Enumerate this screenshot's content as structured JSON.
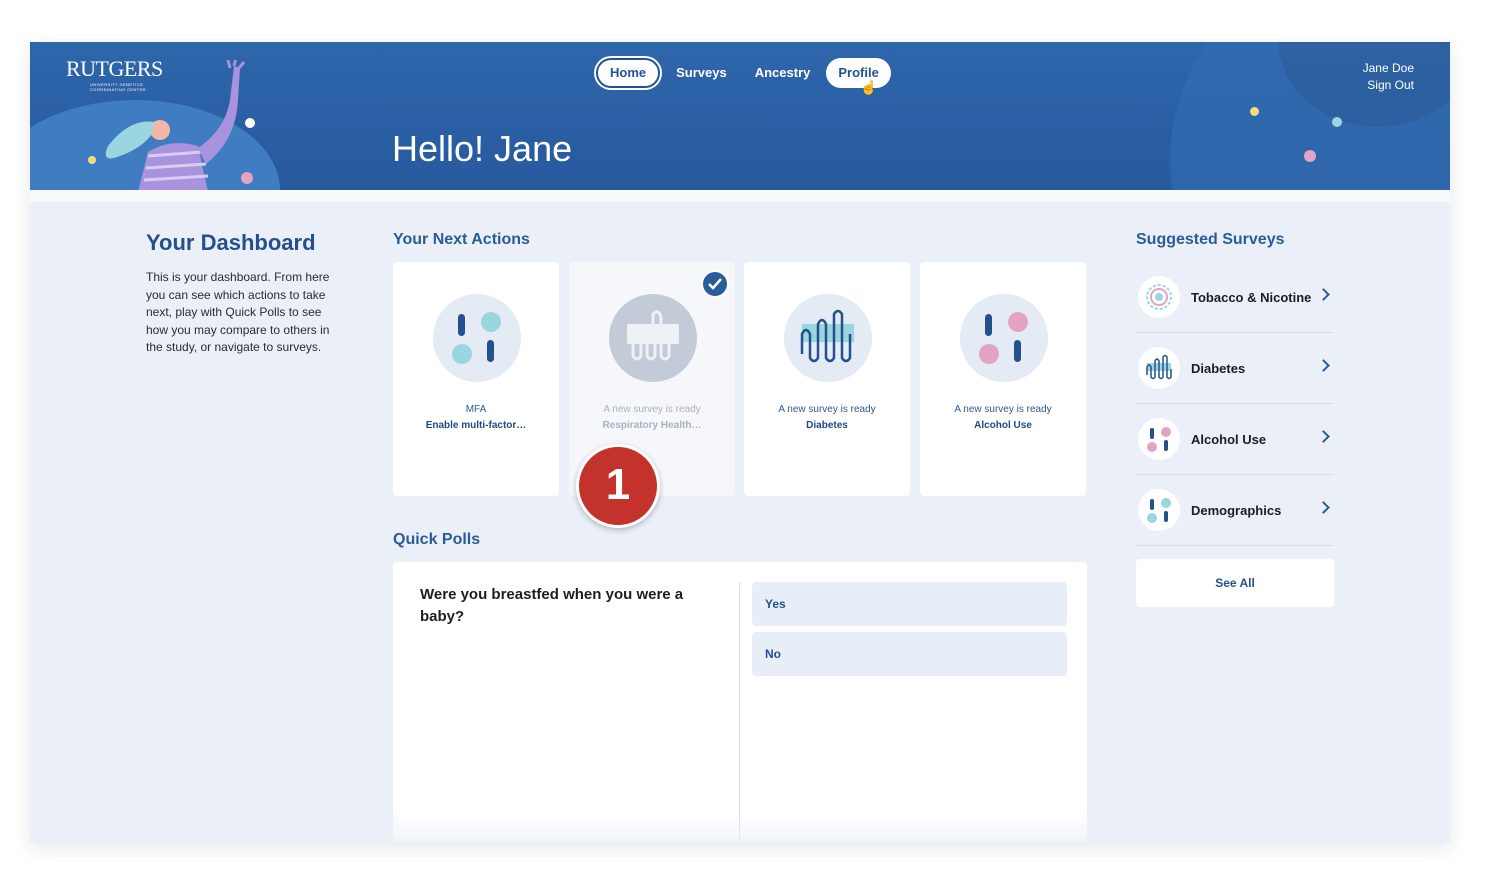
{
  "header": {
    "logo_text": "RUTGERS",
    "logo_subtext": "UNIVERSITY GENETICS COORDINATING CENTER",
    "nav": [
      {
        "label": "Home"
      },
      {
        "label": "Surveys"
      },
      {
        "label": "Ancestry"
      },
      {
        "label": "Profile"
      }
    ],
    "user_name": "Jane Doe",
    "sign_out": "Sign Out",
    "greeting": "Hello! Jane"
  },
  "dashboard": {
    "title": "Your Dashboard",
    "description": "This is your dashboard. From here you can see which actions to take next, play with Quick Polls to see how you may compare to others in the study, or navigate to surveys."
  },
  "next_actions": {
    "title": "Your Next Actions",
    "cards": [
      {
        "line1": "MFA",
        "line2": "Enable multi-factor…",
        "icon": "pills-icon",
        "completed": false
      },
      {
        "line1": "A new survey is ready",
        "line2": "Respiratory Health…",
        "icon": "lungs-icon",
        "completed": true
      },
      {
        "line1": "A new survey is ready",
        "line2": "Diabetes",
        "icon": "diabetes-chart-icon",
        "completed": false
      },
      {
        "line1": "A new survey is ready",
        "line2": "Alcohol Use",
        "icon": "alcohol-pills-icon",
        "completed": false
      }
    ],
    "step_badge": "1"
  },
  "quick_polls": {
    "title": "Quick Polls",
    "question": "Were you breastfed when you were a baby?",
    "options": [
      "Yes",
      "No"
    ]
  },
  "suggested": {
    "title": "Suggested Surveys",
    "items": [
      {
        "label": "Tobacco & Nicotine",
        "icon": "tobacco-target-icon"
      },
      {
        "label": "Diabetes",
        "icon": "diabetes-chart-icon"
      },
      {
        "label": "Alcohol Use",
        "icon": "alcohol-pills-icon"
      },
      {
        "label": "Demographics",
        "icon": "demographics-pills-icon"
      }
    ],
    "see_all": "See All"
  },
  "colors": {
    "header_blue": "#2b62a7",
    "accent": "#24508e",
    "badge_red": "#c4332b",
    "pink": "#e3a4c3",
    "teal": "#9ad6df"
  }
}
